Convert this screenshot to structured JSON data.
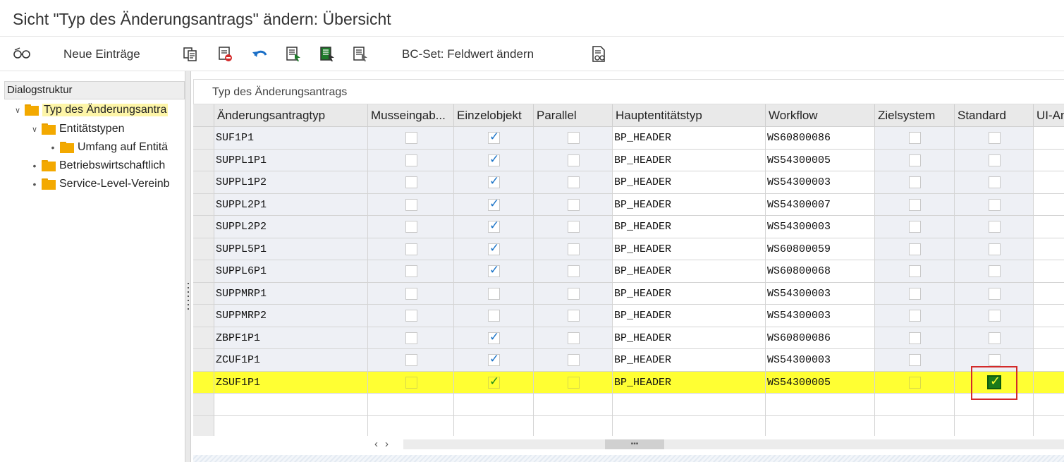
{
  "window": {
    "title": "Sicht \"Typ des Änderungsantrags\" ändern: Übersicht"
  },
  "toolbar": {
    "new_entries_label": "Neue Einträge",
    "bcset_label": "BC-Set: Feldwert ändern"
  },
  "dialog_structure": {
    "header": "Dialogstruktur",
    "items": [
      {
        "label": "Typ des Änderungsantra",
        "level": 0,
        "expanded": true,
        "selected": true
      },
      {
        "label": "Entitätstypen",
        "level": 1,
        "expanded": true,
        "selected": false
      },
      {
        "label": "Umfang auf Entitä",
        "level": 2,
        "expanded": false,
        "selected": false
      },
      {
        "label": "Betriebswirtschaftlich",
        "level": 1,
        "expanded": false,
        "selected": false
      },
      {
        "label": "Service-Level-Vereinb",
        "level": 1,
        "expanded": false,
        "selected": false
      }
    ]
  },
  "table": {
    "panel_title": "Typ des Änderungsantrags",
    "columns": [
      "Änderungsantragtyp",
      "Musseingab...",
      "Einzelobjekt",
      "Parallel",
      "Hauptentitätstyp",
      "Workflow",
      "Zielsystem",
      "Standard",
      "UI-An"
    ],
    "rows": [
      {
        "typ": "SUF1P1",
        "musseingabe": false,
        "einzelobjekt": true,
        "parallel": false,
        "hauptentitaet": "BP_HEADER",
        "workflow": "WS60800086",
        "zielsystem": false,
        "standard": false
      },
      {
        "typ": "SUPPL1P1",
        "musseingabe": false,
        "einzelobjekt": true,
        "parallel": false,
        "hauptentitaet": "BP_HEADER",
        "workflow": "WS54300005",
        "zielsystem": false,
        "standard": false
      },
      {
        "typ": "SUPPL1P2",
        "musseingabe": false,
        "einzelobjekt": true,
        "parallel": false,
        "hauptentitaet": "BP_HEADER",
        "workflow": "WS54300003",
        "zielsystem": false,
        "standard": false
      },
      {
        "typ": "SUPPL2P1",
        "musseingabe": false,
        "einzelobjekt": true,
        "parallel": false,
        "hauptentitaet": "BP_HEADER",
        "workflow": "WS54300007",
        "zielsystem": false,
        "standard": false
      },
      {
        "typ": "SUPPL2P2",
        "musseingabe": false,
        "einzelobjekt": true,
        "parallel": false,
        "hauptentitaet": "BP_HEADER",
        "workflow": "WS54300003",
        "zielsystem": false,
        "standard": false
      },
      {
        "typ": "SUPPL5P1",
        "musseingabe": false,
        "einzelobjekt": true,
        "parallel": false,
        "hauptentitaet": "BP_HEADER",
        "workflow": "WS60800059",
        "zielsystem": false,
        "standard": false
      },
      {
        "typ": "SUPPL6P1",
        "musseingabe": false,
        "einzelobjekt": true,
        "parallel": false,
        "hauptentitaet": "BP_HEADER",
        "workflow": "WS60800068",
        "zielsystem": false,
        "standard": false
      },
      {
        "typ": "SUPPMRP1",
        "musseingabe": false,
        "einzelobjekt": false,
        "parallel": false,
        "hauptentitaet": "BP_HEADER",
        "workflow": "WS54300003",
        "zielsystem": false,
        "standard": false
      },
      {
        "typ": "SUPPMRP2",
        "musseingabe": false,
        "einzelobjekt": false,
        "parallel": false,
        "hauptentitaet": "BP_HEADER",
        "workflow": "WS54300003",
        "zielsystem": false,
        "standard": false
      },
      {
        "typ": "ZBPF1P1",
        "musseingabe": false,
        "einzelobjekt": true,
        "parallel": false,
        "hauptentitaet": "BP_HEADER",
        "workflow": "WS60800086",
        "zielsystem": false,
        "standard": false
      },
      {
        "typ": "ZCUF1P1",
        "musseingabe": false,
        "einzelobjekt": true,
        "parallel": false,
        "hauptentitaet": "BP_HEADER",
        "workflow": "WS54300003",
        "zielsystem": false,
        "standard": false
      },
      {
        "typ": "ZSUF1P1",
        "musseingabe": false,
        "einzelobjekt": true,
        "parallel": false,
        "hauptentitaet": "BP_HEADER",
        "workflow": "WS54300005",
        "zielsystem": false,
        "standard": true,
        "highlighted": true
      }
    ]
  },
  "colors": {
    "highlight": "#ffff33",
    "checkbox_check": "#1a73c7",
    "standard_check": "#1a7a1a",
    "annotation_box": "#d32a2a",
    "folder": "#f3a900"
  }
}
